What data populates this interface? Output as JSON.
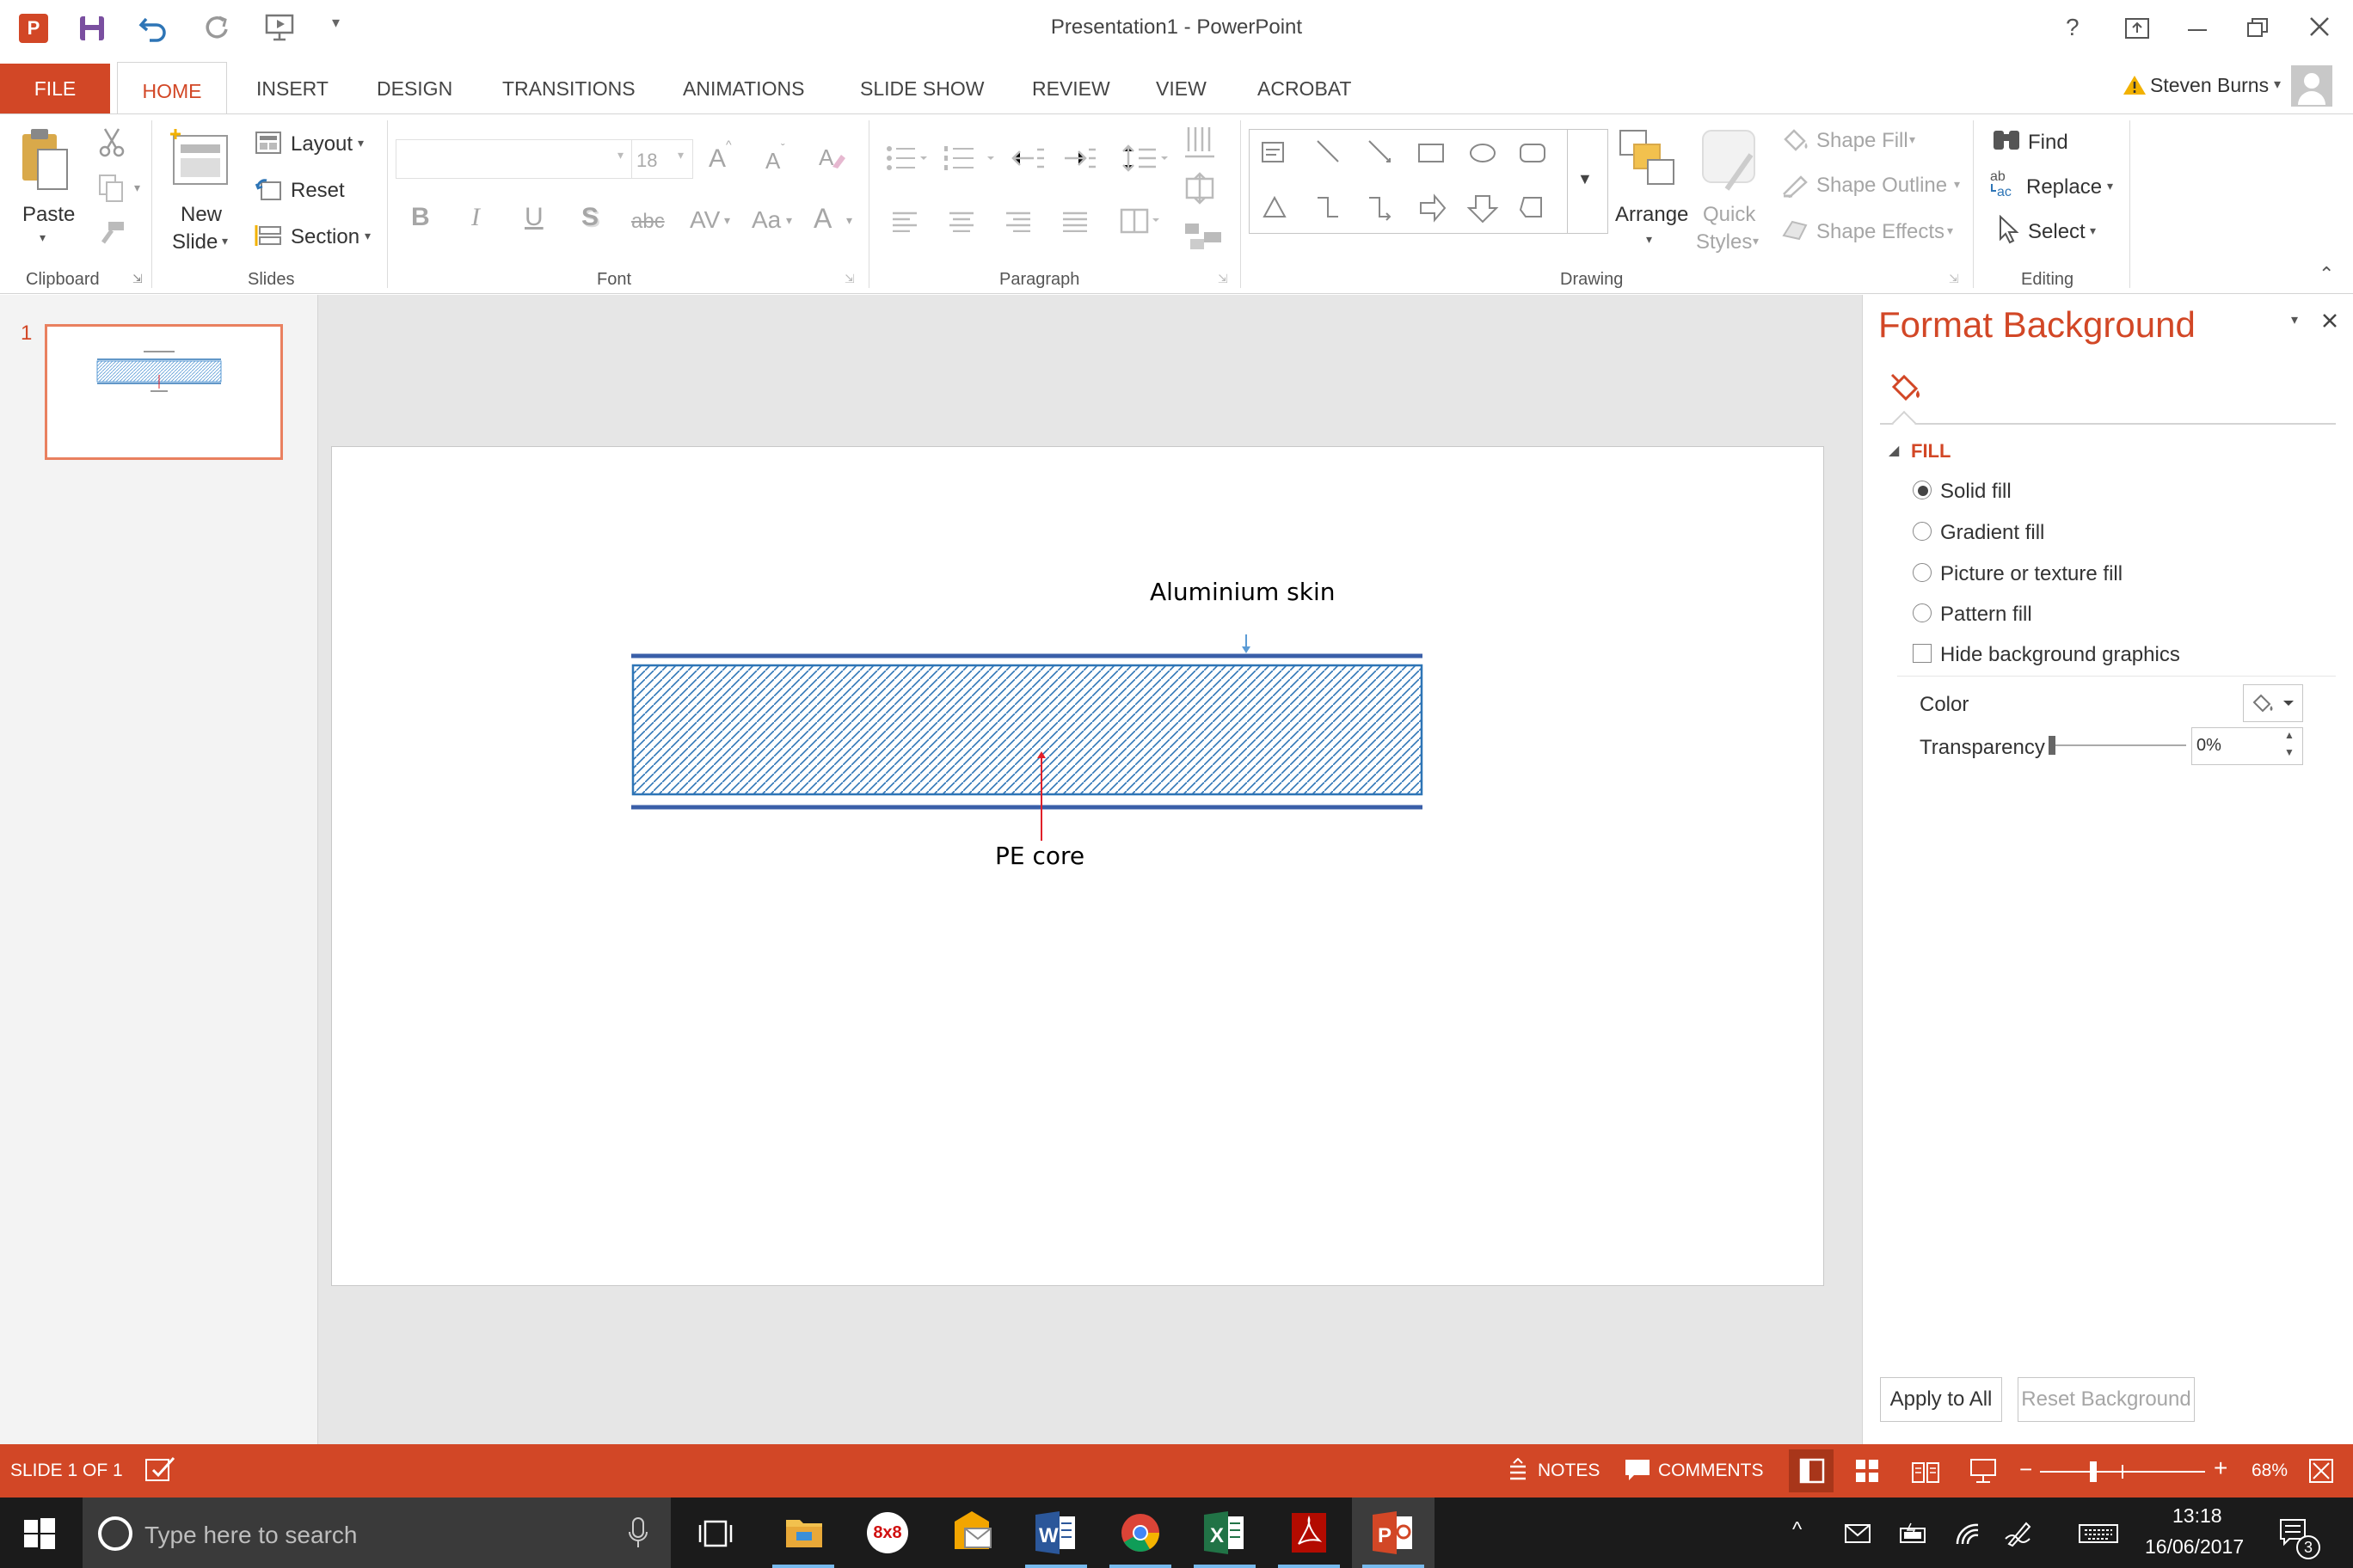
{
  "window": {
    "title": "Presentation1 - PowerPoint",
    "help": "?"
  },
  "user": {
    "name": "Steven Burns"
  },
  "tabs": [
    "FILE",
    "HOME",
    "INSERT",
    "DESIGN",
    "TRANSITIONS",
    "ANIMATIONS",
    "SLIDE SHOW",
    "REVIEW",
    "VIEW",
    "ACROBAT"
  ],
  "ribbon": {
    "clipboard": {
      "paste": "Paste",
      "group": "Clipboard"
    },
    "slides": {
      "new_slide_1": "New",
      "new_slide_2": "Slide",
      "layout": "Layout",
      "reset": "Reset",
      "section": "Section",
      "group": "Slides"
    },
    "font": {
      "size": "18",
      "group": "Font",
      "bold": "B",
      "italic": "I",
      "underline": "U",
      "shadow": "S",
      "strike": "abc",
      "spacing": "AV",
      "case": "Aa",
      "color": "A",
      "grow": "A",
      "shrink": "A"
    },
    "paragraph": {
      "group": "Paragraph"
    },
    "drawing": {
      "arrange": "Arrange",
      "quick_1": "Quick",
      "quick_2": "Styles",
      "shape_fill": "Shape Fill",
      "shape_outline": "Shape Outline",
      "shape_effects": "Shape Effects",
      "group": "Drawing"
    },
    "editing": {
      "find": "Find",
      "replace": "Replace",
      "select": "Select",
      "group": "Editing"
    }
  },
  "thumbnail": {
    "number": "1"
  },
  "slide": {
    "label_top": "Aluminium skin",
    "label_bottom": "PE core"
  },
  "format_pane": {
    "title": "Format Background",
    "section": "FILL",
    "options": [
      "Solid fill",
      "Gradient fill",
      "Picture or texture fill",
      "Pattern fill"
    ],
    "selected_option": "Solid fill",
    "hide_bg": "Hide background graphics",
    "color_label": "Color",
    "transparency_label": "Transparency",
    "transparency_value": "0%",
    "apply_all": "Apply to All",
    "reset_bg": "Reset Background"
  },
  "status": {
    "slide": "SLIDE 1 OF 1",
    "notes": "NOTES",
    "comments": "COMMENTS",
    "zoom": "68%"
  },
  "taskbar": {
    "search_placeholder": "Type here to search",
    "time": "13:18",
    "date": "16/06/2017",
    "notif_count": "3",
    "app_8x8": "8x8"
  },
  "colors": {
    "accent": "#d24726",
    "hatch": "#2e75b6",
    "arrow_top": "#5b9bd5",
    "arrow_bottom": "#e0202a"
  }
}
